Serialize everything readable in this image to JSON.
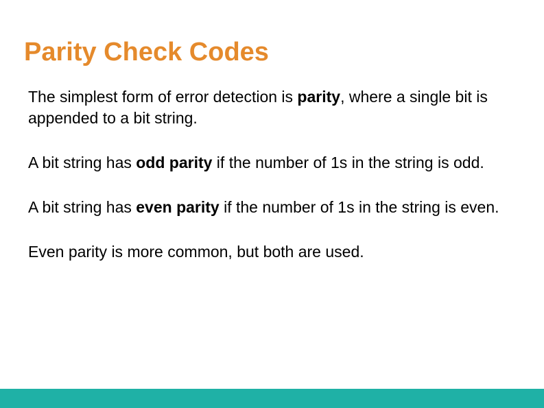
{
  "title": "Parity Check Codes",
  "p1": {
    "pre": "The simplest form of error detection is ",
    "kw": "parity",
    "post": ", where a single bit is appended to a bit string."
  },
  "p2": {
    "pre": "A bit string has ",
    "kw": "odd parity",
    "post": " if the number of 1s in the string is odd."
  },
  "p3": {
    "pre": "A bit string has ",
    "kw": "even parity",
    "post": " if the number of 1s in the string is even."
  },
  "p4": "Even parity is more common, but both are used."
}
